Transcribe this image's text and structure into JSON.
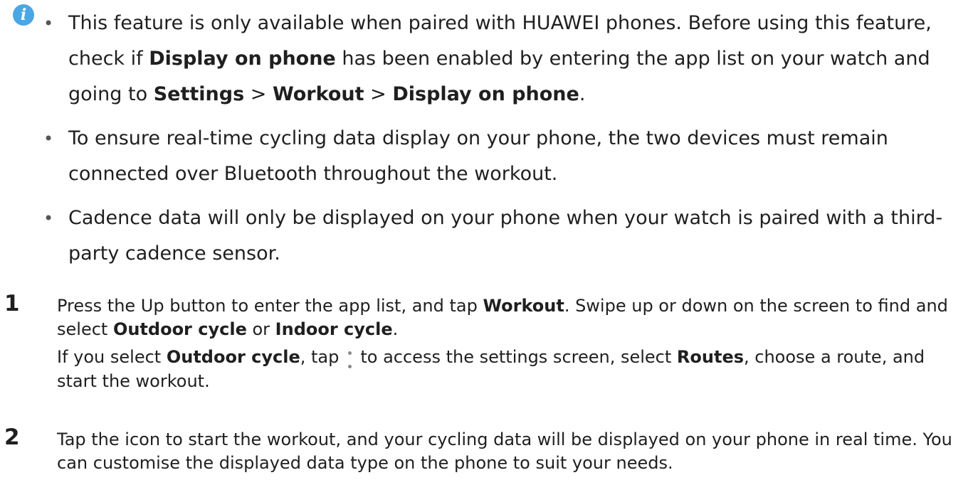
{
  "notes": [
    {
      "parts": [
        "This feature is only available when paired with HUAWEI phones. Before using this feature, check if ",
        "Display on phone",
        " has been enabled by entering the app list on your watch and going to ",
        "Settings",
        " > ",
        "Workout",
        " > ",
        "Display on phone",
        "."
      ]
    },
    {
      "text": "To ensure real-time cycling data display on your phone, the two devices must remain connected over Bluetooth throughout the workout."
    },
    {
      "text": "Cadence data will only be displayed on your phone when your watch is paired with a third-party cadence sensor."
    }
  ],
  "steps": [
    {
      "number": "1",
      "line1": [
        "Press the Up button to enter the app list, and tap ",
        "Workout",
        ". Swipe up or down on the screen to find and select ",
        "Outdoor cycle",
        " or ",
        "Indoor cycle",
        "."
      ],
      "line2": [
        "If you select ",
        "Outdoor cycle",
        ", tap",
        "to access the settings screen, select ",
        "Routes",
        ", choose a route, and start the workout."
      ]
    },
    {
      "number": "2",
      "text": "Tap the icon to start the workout, and your cycling data will be displayed on your phone in real time. You can customise the displayed data type on the phone to suit your needs."
    }
  ],
  "icons": {
    "info": "info-icon",
    "more": "more-vertical-icon"
  },
  "colors": {
    "info_icon": "#4aa6e4",
    "text": "#1f1f1f"
  }
}
